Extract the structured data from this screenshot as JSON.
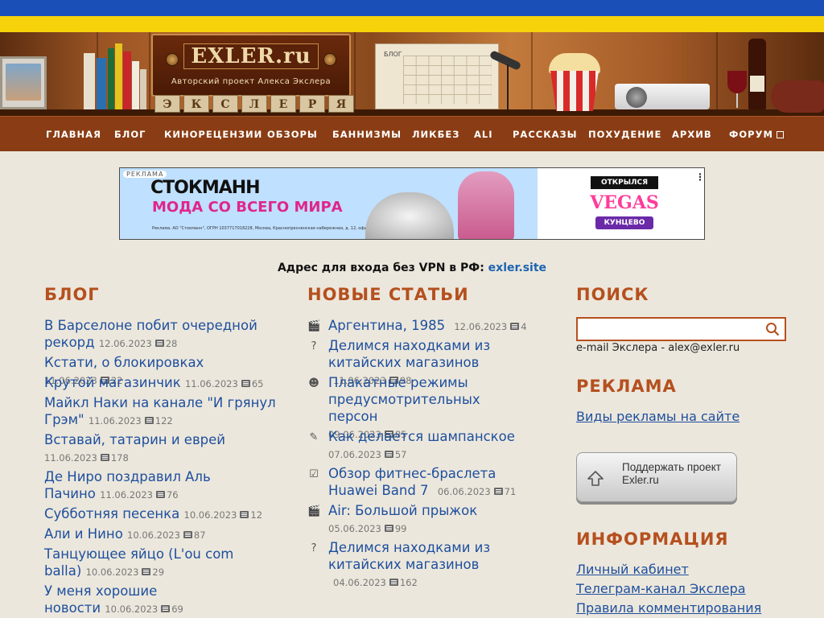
{
  "site": {
    "logo_text": "EXLER.ru",
    "logo_subtitle": "Авторский проект Алекса Экслера",
    "letter_tiles": [
      "Э",
      "К",
      "С",
      "Л",
      "Е",
      "Р",
      "Я"
    ],
    "calendar_label": "БЛОГ"
  },
  "nav": {
    "items": [
      "ГЛАВНАЯ",
      "БЛОГ",
      "КИНОРЕЦЕНЗИИ",
      "ОБЗОРЫ",
      "БАННИЗМЫ",
      "ЛИКБЕЗ",
      "ALI",
      "РАССКАЗЫ",
      "ПОХУДЕНИЕ",
      "АРХИВ",
      "ФОРУМ"
    ]
  },
  "ad": {
    "tag": "РЕКЛАМА",
    "brand": "СТОКМАНН",
    "slogan": "МОДА СО ВСЕГО МИРА",
    "fine_print": "Реклама. АО \"Стокманн\", ОГРН 1037717018228, Москва, Краснопресненская набережная, д. 12, офис",
    "opened": "ОТКРЫЛСЯ",
    "vegas": "VEGAS",
    "kuntsevo": "КУНЦЕВО",
    "menu": "⋮"
  },
  "vpn": {
    "text": "Адрес для входа без VPN в РФ:",
    "link": "exler.site"
  },
  "blog": {
    "heading": "БЛОГ",
    "items": [
      {
        "title": "В Барселоне побит очередной рекорд",
        "date": "12.06.2023",
        "comments": "28"
      },
      {
        "title": "Кстати, о блокировках",
        "date": "11.06.2023",
        "comments": "22"
      },
      {
        "title": "Крутой магазинчик",
        "date": "11.06.2023",
        "comments": "65"
      },
      {
        "title": "Майкл Наки на канале \"И грянул Грэм\"",
        "date": "11.06.2023",
        "comments": "122"
      },
      {
        "title": "Вставай, татарин и еврей",
        "date": "11.06.2023",
        "comments": "178"
      },
      {
        "title": "Де Ниро поздравил Аль Пачино",
        "date": "11.06.2023",
        "comments": "76"
      },
      {
        "title": "Субботняя песенка",
        "date": "10.06.2023",
        "comments": "12"
      },
      {
        "title": "Али и Нино",
        "date": "10.06.2023",
        "comments": "87"
      },
      {
        "title": "Танцующее яйцо (L'ou com balla)",
        "date": "10.06.2023",
        "comments": "29"
      },
      {
        "title": "У меня хорошие новости",
        "date": "10.06.2023",
        "comments": "69"
      }
    ]
  },
  "articles": {
    "heading": "НОВЫЕ СТАТЬИ",
    "items": [
      {
        "icon": "movie-icon",
        "title": "Аргентина, 1985",
        "date": "12.06.2023",
        "comments": "4"
      },
      {
        "icon": "question-icon",
        "title": "Делимся находками из китайских магазинов",
        "date": "11.06.2023",
        "comments": "98"
      },
      {
        "icon": "smile-icon",
        "title": "Плакатные режимы предусмотрительных персон",
        "date": "09.06.2023",
        "comments": "85"
      },
      {
        "icon": "pencil-icon",
        "title": "Как делается шампанское",
        "date": "07.06.2023",
        "comments": "57"
      },
      {
        "icon": "checklist-icon",
        "title": "Обзор фитнес-браслета Huawei Band 7",
        "date": "06.06.2023",
        "comments": "71"
      },
      {
        "icon": "movie-icon",
        "title": "Air: Большой прыжок",
        "date": "05.06.2023",
        "comments": "99"
      },
      {
        "icon": "question-icon",
        "title": "Делимся находками из китайских магазинов",
        "date": "04.06.2023",
        "comments": "162"
      }
    ]
  },
  "sidebar": {
    "search_heading": "ПОИСК",
    "search_value": "",
    "email_line": "e-mail Экслера - alex@exler.ru",
    "ads_heading": "РЕКЛАМА",
    "ads_link": "Виды рекламы на сайте",
    "support_line1": "Поддержать проект",
    "support_line2": "Exler.ru",
    "info_heading": "ИНФОРМАЦИЯ",
    "info_links": [
      "Личный кабинет",
      "Телеграм-канал Экслера",
      "Правила комментирования"
    ]
  },
  "colors": {
    "accent": "#b5501f",
    "link": "#1d4f9e",
    "nav_bg": "#8a3d14",
    "page_bg": "#ece7dc"
  }
}
